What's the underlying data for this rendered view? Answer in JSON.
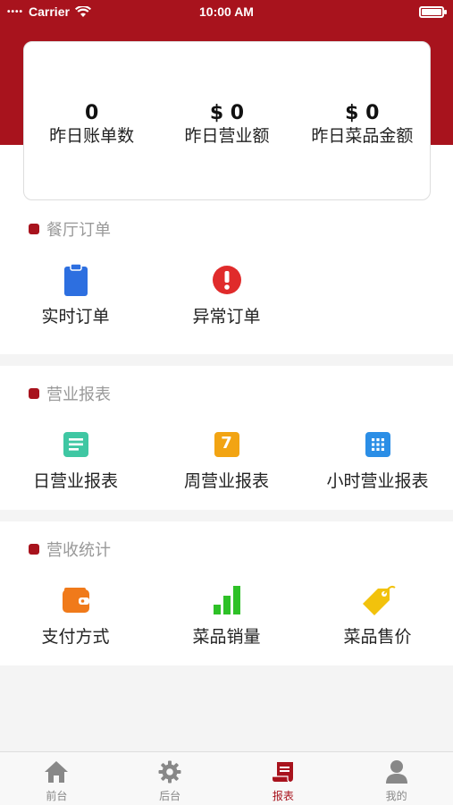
{
  "status_bar": {
    "carrier": "Carrier",
    "time": "10:00 AM"
  },
  "summary": {
    "stats": [
      {
        "value": "0",
        "label": "昨日账单数"
      },
      {
        "value": "$ 0",
        "label": "昨日营业额"
      },
      {
        "value": "$ 0",
        "label": "昨日菜品金额"
      }
    ]
  },
  "sections": [
    {
      "title": "餐厅订单",
      "items": [
        {
          "label": "实时订单",
          "icon": "clipboard-icon",
          "color": "#2d6fe0"
        },
        {
          "label": "异常订单",
          "icon": "alert-icon",
          "color": "#e02b2b"
        }
      ]
    },
    {
      "title": "营业报表",
      "items": [
        {
          "label": "日营业报表",
          "icon": "document-icon",
          "color": "#3fc7a3"
        },
        {
          "label": "周营业报表",
          "icon": "calendar-7-icon",
          "color": "#f2a413",
          "badge": "7"
        },
        {
          "label": "小时营业报表",
          "icon": "grid-icon",
          "color": "#2b8ee6"
        }
      ]
    },
    {
      "title": "营收统计",
      "items": [
        {
          "label": "支付方式",
          "icon": "wallet-icon",
          "color": "#f07a1a"
        },
        {
          "label": "菜品销量",
          "icon": "bar-chart-icon",
          "color": "#2ec127"
        },
        {
          "label": "菜品售价",
          "icon": "price-tag-icon",
          "color": "#f2c20c"
        }
      ]
    }
  ],
  "tabbar": {
    "tabs": [
      {
        "label": "前台",
        "icon": "home-icon",
        "active": false
      },
      {
        "label": "后台",
        "icon": "gear-icon",
        "active": false
      },
      {
        "label": "报表",
        "icon": "report-scroll-icon",
        "active": true
      },
      {
        "label": "我的",
        "icon": "user-icon",
        "active": false
      }
    ]
  },
  "colors": {
    "brand": "#a8131d",
    "inactive_tab": "#888888",
    "section_title": "#999999"
  }
}
